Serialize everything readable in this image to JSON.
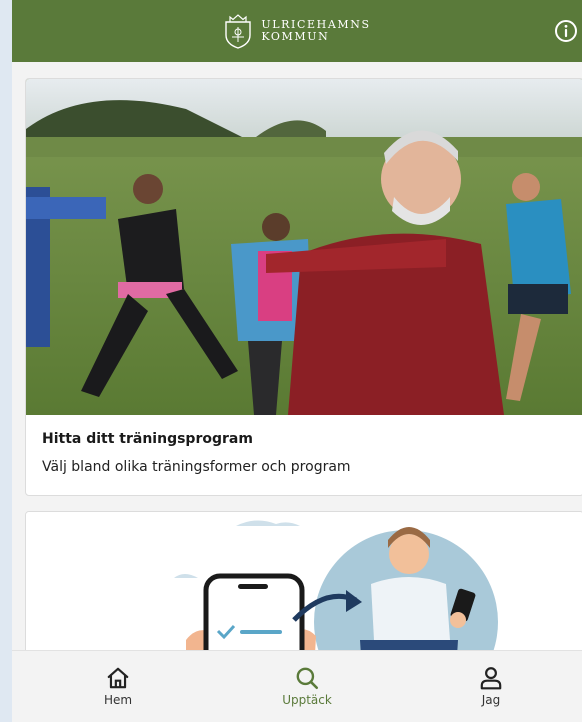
{
  "header": {
    "logo_line1": "ULRICEHAMNS",
    "logo_line2": "KOMMUN",
    "info_icon": "info-circle-icon"
  },
  "cards": [
    {
      "image": "outdoor-group-stretching-photo",
      "title": "Hitta ditt träningsprogram",
      "description": "Välj bland olika träningsformer och program"
    },
    {
      "image": "phone-and-man-illustration"
    }
  ],
  "bottom_nav": {
    "items": [
      {
        "label": "Hem",
        "icon": "home-icon",
        "active": false
      },
      {
        "label": "Upptäck",
        "icon": "search-icon",
        "active": true
      },
      {
        "label": "Jag",
        "icon": "user-icon",
        "active": false
      }
    ]
  },
  "colors": {
    "brand_green": "#5a7a3a",
    "background": "#f3f3f3",
    "page_background": "#dfe8f2"
  }
}
